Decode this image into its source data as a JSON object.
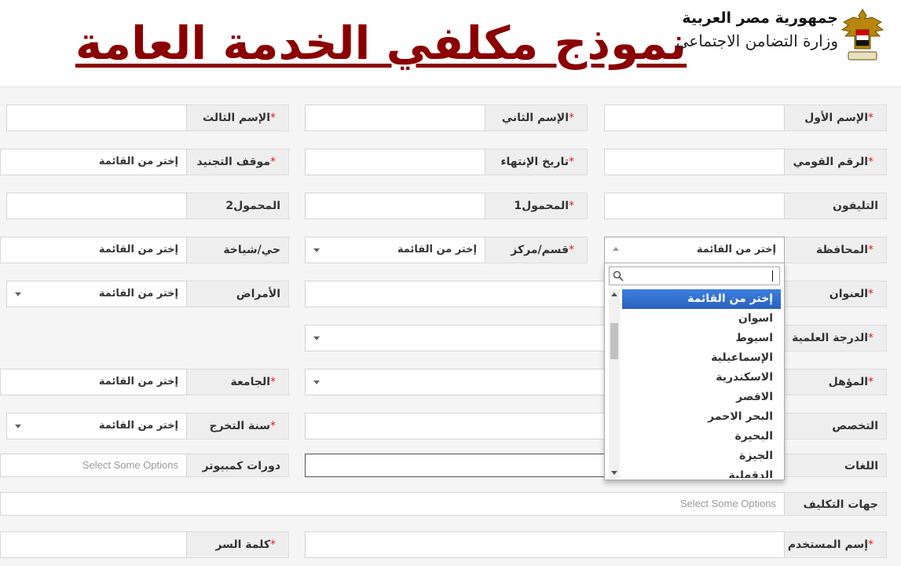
{
  "header": {
    "title": "نموذج مكلفي الخدمة العامة",
    "gov_line1": "جمهورية مصر العربية",
    "gov_line2": "وزارة التضامن الاجتماعي"
  },
  "required_mark": "*",
  "form": {
    "first_name": {
      "label": "الإسم الأول",
      "value": ""
    },
    "second_name": {
      "label": "الإسم الثاني",
      "value": ""
    },
    "third_name": {
      "label": "الإسم الثالث",
      "value": ""
    },
    "national_id": {
      "label": "الرقم القومي",
      "value": ""
    },
    "end_date": {
      "label": "تاريخ الإنتهاء",
      "value": ""
    },
    "military_status": {
      "label": "موقف التجنيد",
      "value": "إختر من القائمة"
    },
    "phone": {
      "label": "التليفون",
      "value": ""
    },
    "mobile1": {
      "label": "المحمول1",
      "value": ""
    },
    "mobile2": {
      "label": "المحمول2",
      "value": ""
    },
    "governorate": {
      "label": "المحافظة",
      "value": "إختر من القائمة"
    },
    "district": {
      "label": "قسم/مركز",
      "value": "إختر من القائمة"
    },
    "neighborhood": {
      "label": "حي/شياخة",
      "value": "إختر من القائمة"
    },
    "address": {
      "label": "العنوان",
      "value": ""
    },
    "diseases": {
      "label": "الأمراض",
      "value": "إختر من القائمة"
    },
    "degree": {
      "label": "الدرجة العلمية",
      "value": ""
    },
    "qualification": {
      "label": "المؤهل",
      "value": ""
    },
    "university": {
      "label": "الجامعة",
      "value": "إختر من القائمة"
    },
    "specialization": {
      "label": "التخصص",
      "value": ""
    },
    "graduation_year": {
      "label": "سنة التخرج",
      "value": "إختر من القائمة"
    },
    "languages": {
      "label": "اللغات",
      "value": ""
    },
    "computer_courses": {
      "label": "دورات كمبيوتر",
      "placeholder": "Select Some Options"
    },
    "assignment_entities": {
      "label": "جهات التكليف",
      "placeholder": "Select Some Options"
    },
    "username": {
      "label": "إسم المستخدم",
      "value": ""
    },
    "password": {
      "label": "كلمة السر",
      "value": ""
    }
  },
  "governorate_dropdown": {
    "search_value": "",
    "options": [
      "إختر من القائمة",
      "اسوان",
      "اسيوط",
      "الإسماعيلية",
      "الاسكندرية",
      "الاقصر",
      "البحر الاحمر",
      "البحيرة",
      "الجيزة",
      "الدقهلية"
    ],
    "highlighted_index": 0
  },
  "colors": {
    "title": "#8b0000",
    "required": "#e02020",
    "highlight": "#3875d7"
  }
}
